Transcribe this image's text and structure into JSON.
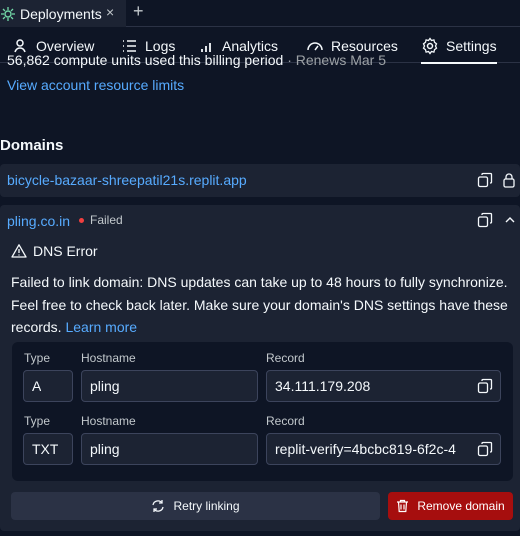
{
  "tabbar": {
    "tab_label": "Deployments",
    "close_glyph": "×",
    "add_glyph": "+",
    "tab_icon": "deployments-icon"
  },
  "nav": {
    "items": [
      {
        "label": "Overview",
        "icon": "overview-icon"
      },
      {
        "label": "Logs",
        "icon": "list-icon"
      },
      {
        "label": "Analytics",
        "icon": "bar-chart-icon"
      },
      {
        "label": "Resources",
        "icon": "gauge-icon"
      },
      {
        "label": "Settings",
        "icon": "gear-icon",
        "active": true
      }
    ]
  },
  "usage": {
    "partial_text": "56,862 compute units used this billing period",
    "partial_renew": "· Renews Mar 5",
    "limits_link": "View account resource limits"
  },
  "domains": {
    "title": "Domains",
    "primary": {
      "domain": "bicycle-bazaar-shreepatil21s.replit.app"
    },
    "custom": {
      "domain": "pling.co.in",
      "status": "Failed",
      "error_title": "DNS Error",
      "message": "Failed to link domain: DNS updates can take up to 48 hours to fully synchronize. Feel free to check back later. Make sure your domain's DNS settings have these records.",
      "learn_more": "Learn more",
      "records": [
        {
          "type_label": "Type",
          "hostname_label": "Hostname",
          "record_label": "Record",
          "type": "A",
          "hostname": "pling",
          "record": "34.111.179.208"
        },
        {
          "type_label": "Type",
          "hostname_label": "Hostname",
          "record_label": "Record",
          "type": "TXT",
          "hostname": "pling",
          "record": "replit-verify=4bcbc819-6f2c-4"
        }
      ],
      "retry_label": "Retry linking",
      "remove_label": "Remove domain"
    }
  },
  "colors": {
    "background": "#0e1525",
    "surface": "#1c2333",
    "link": "#57abff",
    "danger": "#a60e0e",
    "status_failed": "#f23f3f"
  }
}
